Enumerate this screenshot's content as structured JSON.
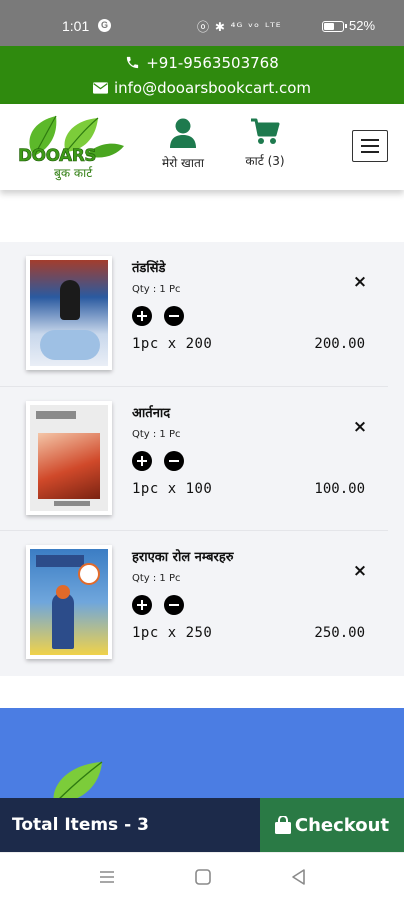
{
  "status_bar": {
    "time": "1:01",
    "g_badge": "G",
    "icons": "ⓞ ✱ ⁴ᴳ ᵛᵒ ᴸᵀᴱ",
    "battery_percent": 52,
    "battery_label": "52%"
  },
  "contact": {
    "phone": "+91-9563503768",
    "email": "info@dooarsbookcart.com"
  },
  "header": {
    "logo_text": "DOOARS",
    "logo_subtext": "बुक कार्ट",
    "account_label": "मेरो खाता",
    "cart_label": "कार्ट (3)",
    "icons": {
      "phone": "phone-icon",
      "email": "envelope-icon",
      "account": "user-icon",
      "cart": "shopping-cart-icon",
      "menu": "hamburger-menu-icon"
    }
  },
  "cart": {
    "items": [
      {
        "title": "तंडसिंडे",
        "qty_label": "Qty : 1 Pc",
        "calc": "1pc  x  200",
        "total": "200.00",
        "remove": "×",
        "cover_colors": [
          "#2a5aa0",
          "#c9d8ec",
          "#a33d2d",
          "#f2f2f2"
        ]
      },
      {
        "title": "आर्तनाद",
        "qty_label": "Qty : 1 Pc",
        "calc": "1pc  x  100",
        "total": "100.00",
        "remove": "×",
        "cover_colors": [
          "#ececec",
          "#d0492a",
          "#8a8a8a",
          "#f4c6a8"
        ]
      },
      {
        "title": "हराएका रोल नम्बरहरु",
        "qty_label": "Qty : 1 Pc",
        "calc": "1pc  x  250",
        "total": "250.00",
        "remove": "×",
        "cover_colors": [
          "#3b7dc4",
          "#e26a2a",
          "#f0d24a",
          "#2c4c8a"
        ]
      }
    ]
  },
  "bottom_bar": {
    "total_items": "Total Items - 3",
    "checkout_label": "Checkout"
  },
  "colors": {
    "contact_bar": "#2f8a0e",
    "footer_band": "#4b7de3",
    "total_bar": "#1c2a4a",
    "checkout": "#2a7a45"
  }
}
